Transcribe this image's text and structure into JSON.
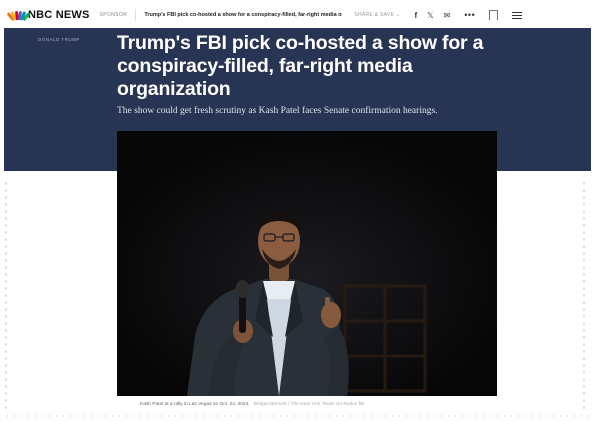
{
  "nav": {
    "logo_text": "NBC NEWS",
    "section": "SPONSOR",
    "headline": "Trump's FBI pick co-hosted a show for a conspiracy-filled, far-right media orga",
    "share_label": "SHARE & SAVE",
    "share_arrow": "⌄",
    "icons": [
      "facebook-icon",
      "x-icon",
      "email-icon",
      "more-icon",
      "bookmark-icon",
      "menu-icon"
    ],
    "facebook": "f",
    "x": "𝕏",
    "email": "✉",
    "more": "•••"
  },
  "hero": {
    "kicker": "DONALD TRUMP",
    "title": "Trump's FBI pick co-hosted a show for a conspiracy-filled, far-right media organization",
    "dek": "The show could get fresh scrutiny as Kash Patel faces Senate confirmation hearings."
  },
  "photo": {
    "caption": "Kash Patel at a rally in Las Vegas on Oct. 24, 2024.",
    "credit": "Bridget Bennett / The New York Times via Redux file"
  },
  "colors": {
    "hero_bg": "#283454",
    "peacock": [
      "#f37021",
      "#fcb711",
      "#6460aa",
      "#0089d0",
      "#0db14b",
      "#cc004c"
    ]
  }
}
